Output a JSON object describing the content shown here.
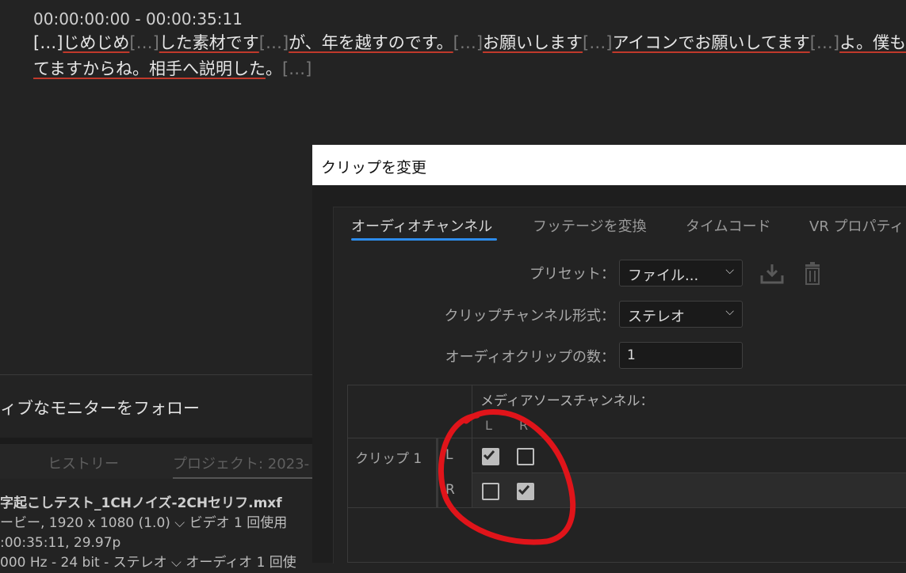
{
  "transcript": {
    "timecode": "00:00:00:00 - 00:00:35:11",
    "line1": [
      {
        "t": "[…]",
        "style": "normal"
      },
      {
        "t": "じめじめ",
        "style": "u"
      },
      {
        "t": "[…]",
        "style": "dots"
      },
      {
        "t": "した素材です",
        "style": "u"
      },
      {
        "t": "[…]",
        "style": "dots"
      },
      {
        "t": "が、年を越すのです。",
        "style": "u"
      },
      {
        "t": "[…]",
        "style": "dots"
      },
      {
        "t": "お願いします",
        "style": "u"
      },
      {
        "t": "[…]",
        "style": "dots"
      },
      {
        "t": "アイコンでお願いしてます",
        "style": "u"
      },
      {
        "t": "[…]",
        "style": "dots"
      },
      {
        "t": "よ。僕も知っ",
        "style": "u"
      }
    ],
    "line2": [
      {
        "t": "てますからね。相手へ説明した",
        "style": "u"
      },
      {
        "t": "。",
        "style": "normal"
      },
      {
        "t": "[…]",
        "style": "dots"
      }
    ]
  },
  "left_panel": {
    "follow_label": "ィブなモニターをフォロー",
    "tabs": [
      "ヒストリー",
      "プロジェクト: 2023-"
    ],
    "file": {
      "name": "字起こしテスト_1CHノイズ-2CHセリフ.mxf",
      "line2": "ービー, 1920 x 1080 (1.0) ⌵  ビデオ 1 回使用",
      "line3": ":00:35:11, 29.97p",
      "line4": "000 Hz - 24 bit - ステレオ ⌵  オーディオ 1 回使"
    }
  },
  "dialog": {
    "title": "クリップを変更",
    "tabs": [
      "オーディオチャンネル",
      "フッテージを変換",
      "タイムコード",
      "VR プロパティ"
    ],
    "active_tab": 0,
    "preset_label": "プリセット：",
    "preset_value": "ファイル...",
    "format_label": "クリップチャンネル形式：",
    "format_value": "ステレオ",
    "count_label": "オーディオクリップの数：",
    "count_value": "1",
    "table": {
      "header": "メディアソースチャンネル：",
      "columns": [
        "L",
        "R"
      ],
      "clip_label": "クリップ 1",
      "rows": [
        {
          "label": "L",
          "checks": [
            true,
            false
          ]
        },
        {
          "label": "R",
          "checks": [
            false,
            true
          ]
        }
      ]
    }
  },
  "annotation_color": "#e0141a"
}
